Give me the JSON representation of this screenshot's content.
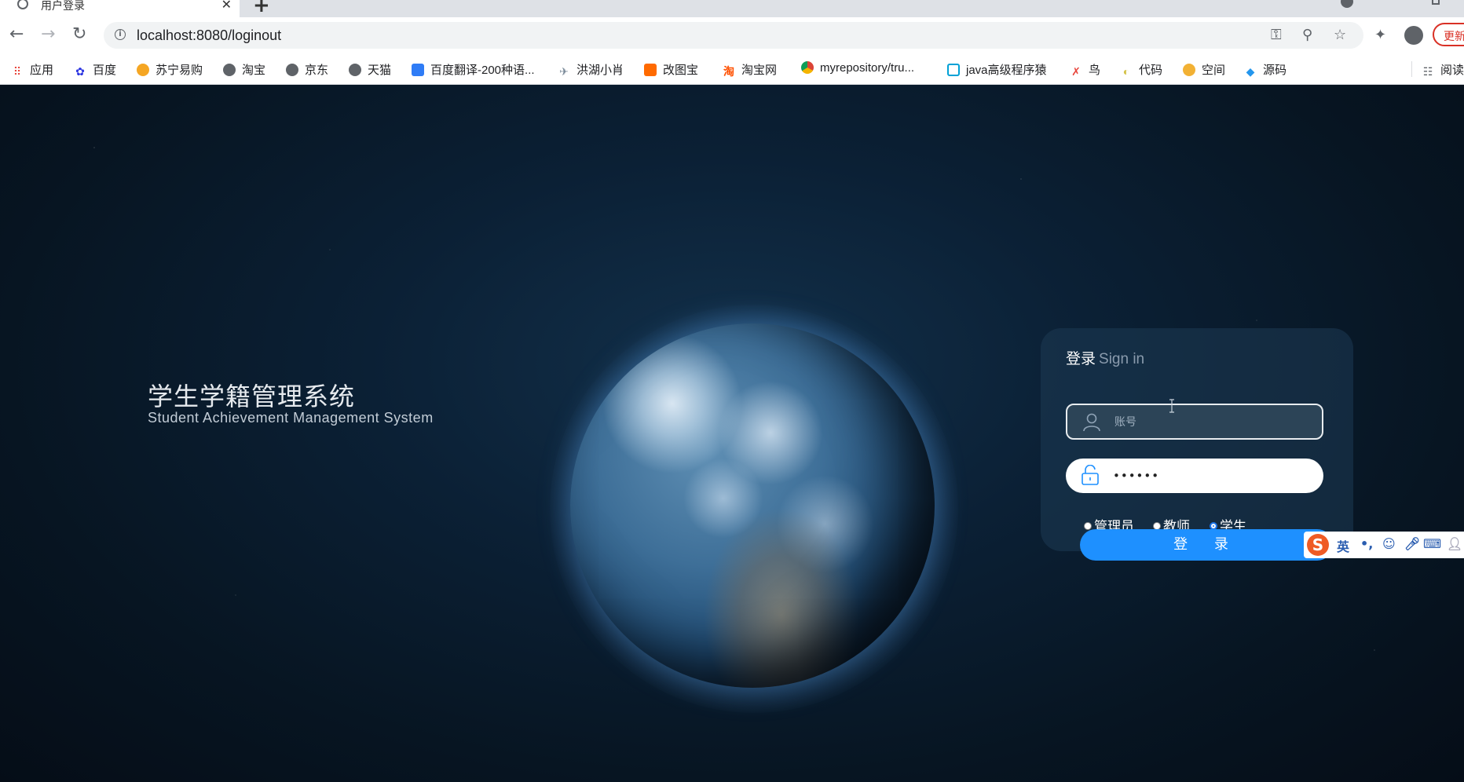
{
  "browser": {
    "tab_title": "用户登录",
    "tab_close": "✕",
    "new_tab": "+",
    "url": "localhost:8080/loginout",
    "update_label": "更新"
  },
  "bookmarks": [
    {
      "label": "应用",
      "icon": "apps-grid-icon",
      "color": "#e8453c"
    },
    {
      "label": "百度",
      "icon": "baidu-paw-icon",
      "color": "#2932e1"
    },
    {
      "label": "苏宁易购",
      "icon": "suning-icon",
      "color": "#f5a623"
    },
    {
      "label": "淘宝",
      "icon": "globe-icon",
      "color": "#5f6368"
    },
    {
      "label": "京东",
      "icon": "globe-icon",
      "color": "#5f6368"
    },
    {
      "label": "天猫",
      "icon": "globe-icon",
      "color": "#5f6368"
    },
    {
      "label": "百度翻译-200种语...",
      "icon": "translate-icon",
      "color": "#2f7cf6"
    },
    {
      "label": "洪湖小肖",
      "icon": "bird-icon",
      "color": "#7a8a99"
    },
    {
      "label": "改图宝",
      "icon": "gaitubao-icon",
      "color": "#ff6a00"
    },
    {
      "label": "淘宝网",
      "icon": "taobao-icon",
      "color": "#ff5000"
    },
    {
      "label": "myrepository/tru...",
      "icon": "chrome-icon",
      "color": "#db4437"
    },
    {
      "label": "java高级程序猿",
      "icon": "bilibili-icon",
      "color": "#00a1d6"
    },
    {
      "label": "鸟",
      "icon": "bird-red-icon",
      "color": "#e8453c"
    },
    {
      "label": "代码",
      "icon": "leaf-icon",
      "color": "#d4c34a"
    },
    {
      "label": "空间",
      "icon": "qzone-icon",
      "color": "#f2b134"
    },
    {
      "label": "源码",
      "icon": "docker-icon",
      "color": "#2496ed"
    }
  ],
  "reading_list_label": "阅读",
  "page": {
    "system_title": "学生学籍管理系统",
    "system_subtitle": "Student Achievement Management System",
    "login": {
      "title_cn": "登录",
      "title_en": "Sign in",
      "account_placeholder": "账号",
      "account_value": "",
      "password_value": "••••••",
      "roles": [
        {
          "label": "管理员",
          "selected": false
        },
        {
          "label": "教师",
          "selected": false
        },
        {
          "label": "学生",
          "selected": true
        }
      ],
      "submit_label": "登 录"
    }
  },
  "ime": {
    "logo": "S",
    "mode": "英",
    "punct": "•,"
  },
  "colors": {
    "accent": "#1e90ff",
    "update_red": "#d93025"
  }
}
